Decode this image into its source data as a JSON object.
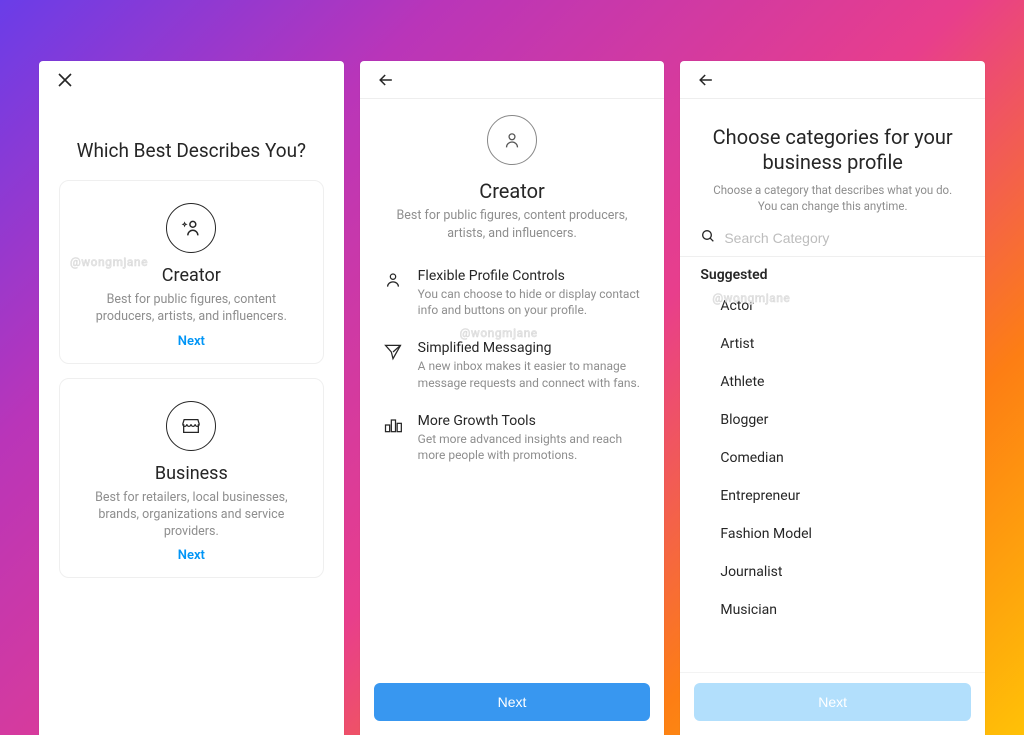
{
  "screen1": {
    "title": "Which Best Describes You?",
    "cards": [
      {
        "title": "Creator",
        "desc": "Best for public figures, content producers, artists, and influencers.",
        "next": "Next"
      },
      {
        "title": "Business",
        "desc": "Best for retailers, local businesses, brands, organizations and service providers.",
        "next": "Next"
      }
    ]
  },
  "screen2": {
    "title": "Creator",
    "subtitle": "Best for public figures, content producers, artists, and influencers.",
    "features": [
      {
        "title": "Flexible Profile Controls",
        "desc": "You can choose to hide or display contact info and buttons on your profile."
      },
      {
        "title": "Simplified Messaging",
        "desc": "A new inbox makes it easier to manage message requests and connect with fans."
      },
      {
        "title": "More Growth Tools",
        "desc": "Get more advanced insights and reach more people with promotions."
      }
    ],
    "next_label": "Next"
  },
  "screen3": {
    "title": "Choose categories for your business profile",
    "subtitle": "Choose a category that describes what you do. You can change this anytime.",
    "search_placeholder": "Search Category",
    "suggested_label": "Suggested",
    "suggested": [
      "Actor",
      "Artist",
      "Athlete",
      "Blogger",
      "Comedian",
      "Entrepreneur",
      "Fashion Model",
      "Journalist",
      "Musician"
    ],
    "next_label": "Next"
  },
  "watermark": "@wongmjane"
}
